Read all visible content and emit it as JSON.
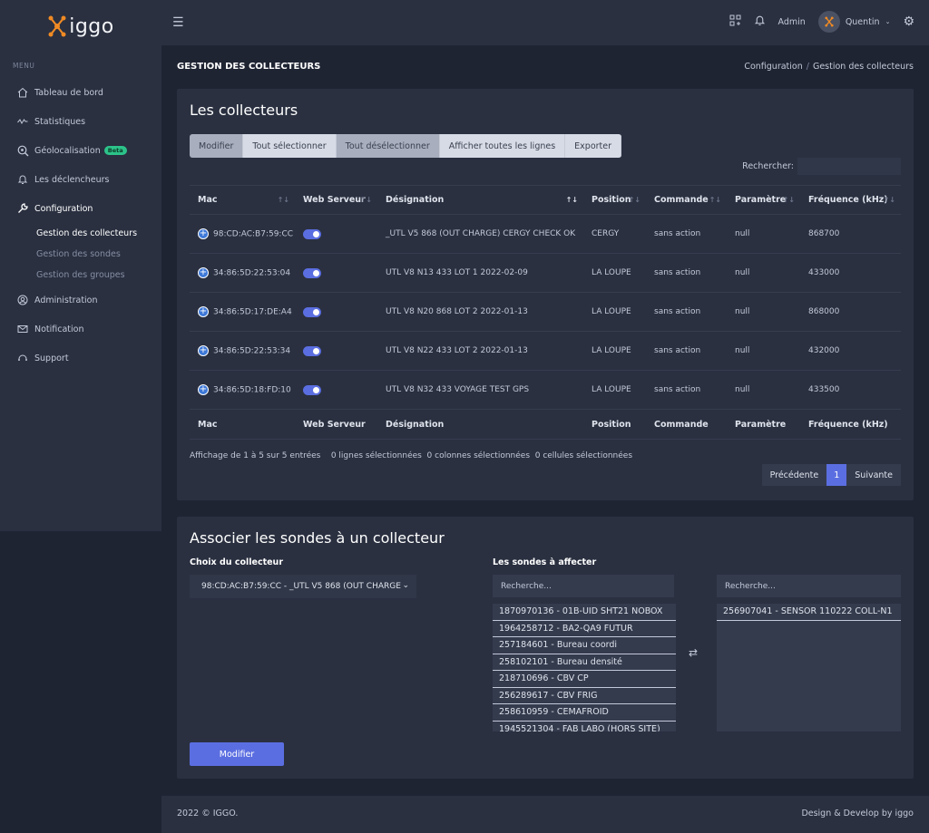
{
  "brand": {
    "name": "iggo",
    "orange": "#f08a24"
  },
  "sidebar": {
    "menu_title": "MENU",
    "items": [
      {
        "label": "Tableau de bord"
      },
      {
        "label": "Statistiques"
      },
      {
        "label": "Géolocalisation",
        "badge": "Beta"
      },
      {
        "label": "Les déclencheurs"
      },
      {
        "label": "Configuration"
      },
      {
        "label": "Administration"
      },
      {
        "label": "Notification"
      },
      {
        "label": "Support"
      }
    ],
    "sub_items": [
      {
        "label": "Gestion des collecteurs"
      },
      {
        "label": "Gestion des sondes"
      },
      {
        "label": "Gestion des groupes"
      }
    ]
  },
  "topbar": {
    "admin_label": "Admin",
    "user_name": "Quentin"
  },
  "page": {
    "title": "GESTION DES COLLECTEURS",
    "breadcrumb": [
      "Configuration",
      "Gestion des collecteurs"
    ]
  },
  "collectors": {
    "title": "Les collecteurs",
    "buttons": [
      "Modifier",
      "Tout sélectionner",
      "Tout désélectionner",
      "Afficher toutes les lignes",
      "Exporter"
    ],
    "search_label": "Rechercher:",
    "columns": [
      "Mac",
      "Web Serveur",
      "Désignation",
      "Position",
      "Commande",
      "Paramètre",
      "Fréquence (kHz)"
    ],
    "rows": [
      {
        "mac": "98:CD:AC:B7:59:CC",
        "designation": "_UTL V5 868 (OUT CHARGE) CERGY CHECK OK",
        "position": "CERGY",
        "commande": "sans action",
        "parametre": "null",
        "frequence": "868700"
      },
      {
        "mac": "34:86:5D:22:53:04",
        "designation": "UTL V8 N13 433 LOT 1 2022-02-09",
        "position": "LA LOUPE",
        "commande": "sans action",
        "parametre": "null",
        "frequence": "433000"
      },
      {
        "mac": "34:86:5D:17:DE:A4",
        "designation": "UTL V8 N20 868 LOT 2 2022-01-13",
        "position": "LA LOUPE",
        "commande": "sans action",
        "parametre": "null",
        "frequence": "868000"
      },
      {
        "mac": "34:86:5D:22:53:34",
        "designation": "UTL V8 N22 433 LOT 2 2022-01-13",
        "position": "LA LOUPE",
        "commande": "sans action",
        "parametre": "null",
        "frequence": "432000"
      },
      {
        "mac": "34:86:5D:18:FD:10",
        "designation": "UTL V8 N32 433 VOYAGE TEST GPS",
        "position": "LA LOUPE",
        "commande": "sans action",
        "parametre": "null",
        "frequence": "433500"
      }
    ],
    "info": "Affichage de 1 à 5 sur 5 entrées    0 lignes sélectionnées  0 colonnes sélectionnées  0 cellules sélectionnées",
    "pager": {
      "prev": "Précédente",
      "current": "1",
      "next": "Suivante"
    }
  },
  "associate": {
    "title": "Associer les sondes à un collecteur",
    "collector_label": "Choix du collecteur",
    "collector_value": "98:CD:AC:B7:59:CC - _UTL V5 868 (OUT CHARGE",
    "probes_label": "Les sondes à affecter",
    "search_placeholder_left": "Recherche...",
    "search_placeholder_right": "Recherche...",
    "available": [
      "1870970136 - 01B-UID SHT21 NOBOX",
      "1964258712 - BA2-QA9 FUTUR",
      "257184601 - Bureau coordi",
      "258102101 - Bureau densité",
      "218710696 - CBV CP",
      "256289617 - CBV FRIG",
      "258610959 - CEMAFROID",
      "1945521304 - FAB LABO (HORS SITE)"
    ],
    "assigned": [
      "256907041 - SENSOR 110222 COLL-N1"
    ],
    "submit": "Modifier"
  },
  "footer": {
    "left": "2022 © IGGO.",
    "right": "Design & Develop by iggo"
  }
}
